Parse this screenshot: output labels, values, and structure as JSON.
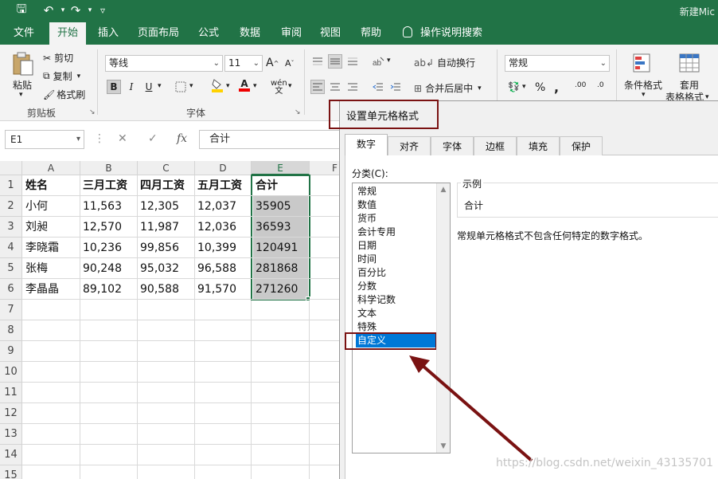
{
  "titlebar": {
    "doc_title": "新建Mic",
    "qa_save": "🖫",
    "qa_undo": "↶",
    "qa_redo": "↷",
    "qa_customize": "▿"
  },
  "tabs": [
    {
      "label": "文件"
    },
    {
      "label": "开始"
    },
    {
      "label": "插入"
    },
    {
      "label": "页面布局"
    },
    {
      "label": "公式"
    },
    {
      "label": "数据"
    },
    {
      "label": "审阅"
    },
    {
      "label": "视图"
    },
    {
      "label": "帮助"
    }
  ],
  "tell_me": "操作说明搜索",
  "ribbon": {
    "clipboard": {
      "paste": "粘贴",
      "cut": "剪切",
      "copy": "复制",
      "format_painter": "格式刷",
      "label": "剪贴板"
    },
    "font": {
      "name": "等线",
      "size": "11",
      "bold": "B",
      "italic": "I",
      "underline": "U",
      "grow": "A",
      "shrink": "A",
      "label": "字体",
      "phonetic": "wén"
    },
    "alignment": {
      "wrap": "自动换行",
      "merge": "合并后居中"
    },
    "number": {
      "format": "常规",
      "percent": "%",
      "comma": ",",
      "inc_dec": ".00",
      "dec_dec": ".0"
    },
    "styles": {
      "conditional": "条件格式",
      "table1": "套用",
      "table2": "表格格式"
    }
  },
  "formula_bar": {
    "name_box": "E1",
    "cancel": "✕",
    "enter": "✓",
    "fx": "fx",
    "formula": "合计"
  },
  "sheet": {
    "columns": [
      "A",
      "B",
      "C",
      "D",
      "E",
      "F"
    ],
    "rows": [
      "1",
      "2",
      "3",
      "4",
      "5",
      "6",
      "7",
      "8",
      "9",
      "10",
      "11",
      "12",
      "13",
      "14",
      "15"
    ],
    "data": [
      [
        "姓名",
        "三月工资",
        "四月工资",
        "五月工资",
        "合计"
      ],
      [
        "小何",
        "11,563",
        "12,305",
        "12,037",
        "35905"
      ],
      [
        "刘昶",
        "12,570",
        "11,987",
        "12,036",
        "36593"
      ],
      [
        "李晓霜",
        "10,236",
        "99,856",
        "10,399",
        "120491"
      ],
      [
        "张梅",
        "90,248",
        "95,032",
        "96,588",
        "281868"
      ],
      [
        "李晶晶",
        "89,102",
        "90,588",
        "91,570",
        "271260"
      ]
    ]
  },
  "dialog": {
    "title": "设置单元格格式",
    "tabs": [
      "数字",
      "对齐",
      "字体",
      "边框",
      "填充",
      "保护"
    ],
    "category_label": "分类(C):",
    "categories": [
      "常规",
      "数值",
      "货币",
      "会计专用",
      "日期",
      "时间",
      "百分比",
      "分数",
      "科学记数",
      "文本",
      "特殊",
      "自定义"
    ],
    "selected_category": "自定义",
    "sample_title": "示例",
    "sample_value": "合计",
    "description": "常规单元格格式不包含任何特定的数字格式。"
  },
  "watermark": "https://blog.csdn.net/weixin_43135701",
  "colors": {
    "excel_green": "#217346",
    "annotation": "#7a1212",
    "selection_blue": "#0078d7"
  }
}
